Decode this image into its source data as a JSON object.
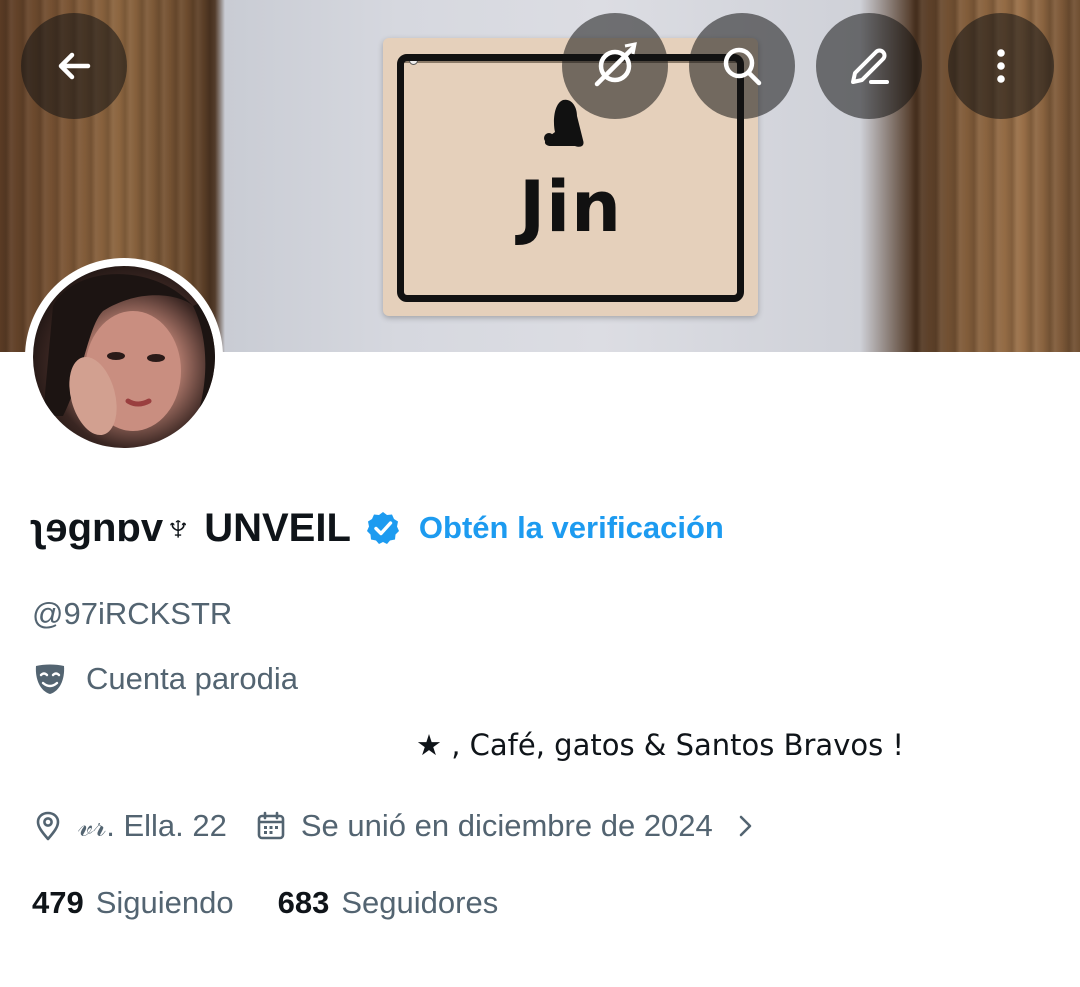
{
  "banner": {
    "sign_text": "Jin"
  },
  "header": {
    "buttons": [
      {
        "name": "back",
        "icon": "arrow-left-icon"
      },
      {
        "name": "grok",
        "icon": "grok-icon"
      },
      {
        "name": "search",
        "icon": "search-icon"
      },
      {
        "name": "edit",
        "icon": "pencil-icon"
      },
      {
        "name": "more",
        "icon": "more-vertical-icon"
      }
    ]
  },
  "profile": {
    "display_name": "ʅɘgnɒv♆ UNVEIL",
    "verified_badge": "verified-icon",
    "get_verified_label": "Obtén la verificación",
    "handle": "@97iRCKSTR",
    "parody_label": "Cuenta parodia",
    "bio": "★ , Café, gatos & Santos Bravos !",
    "location": "𝓋𝓇. Ella. 22",
    "joined": "Se unió en diciembre de 2024",
    "following_count": "479",
    "following_label": "Siguiendo",
    "followers_count": "683",
    "followers_label": "Seguidores"
  },
  "colors": {
    "accent": "#1d9bf0",
    "secondary_text": "#536471",
    "primary_text": "#0f1419"
  }
}
